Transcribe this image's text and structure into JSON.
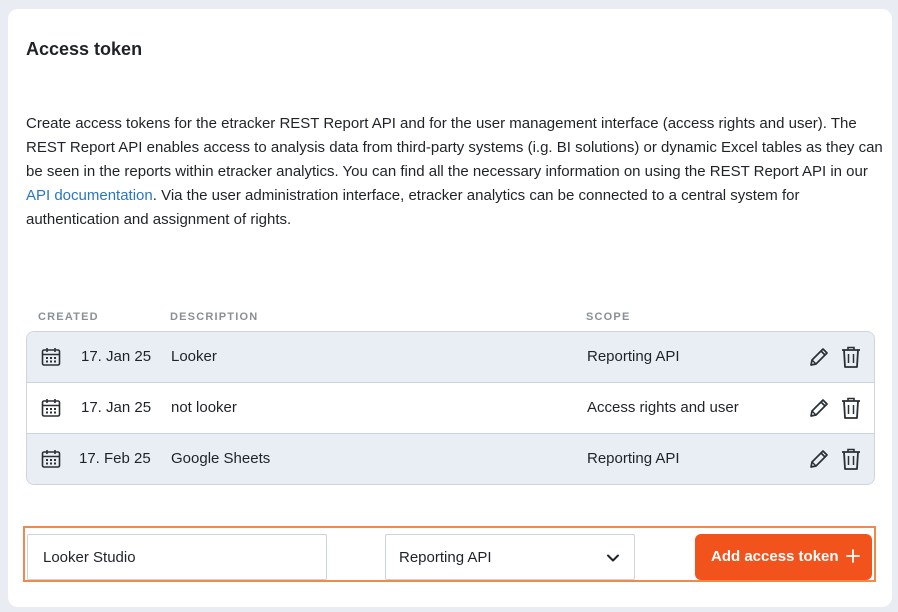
{
  "panel": {
    "title": "Access token",
    "description_part1": "Create access tokens for the etracker REST Report API and for the user management interface (access rights and user). The REST Report API enables access to analysis data from third-party systems (i.g. BI solutions) or dynamic Excel tables as they can be seen in the reports within etracker analytics. You can find all the necessary information on using the REST Report API in our ",
    "description_link": "API documentation",
    "description_part2": ". Via the user administration interface, etracker analytics can be connected to a central system for authentication and assignment of rights."
  },
  "table": {
    "headers": {
      "created": "CREATED",
      "description": "DESCRIPTION",
      "scope": "SCOPE"
    },
    "rows": [
      {
        "created": "17. Jan 25",
        "description": "Looker",
        "scope": "Reporting API"
      },
      {
        "created": "17. Jan 25",
        "description": "not looker",
        "scope": "Access rights and user"
      },
      {
        "created": "17. Feb 25",
        "description": "Google Sheets",
        "scope": "Reporting API"
      }
    ]
  },
  "form": {
    "description_value": "Looker Studio",
    "scope_selected": "Reporting API",
    "add_button_label": "Add access token"
  },
  "colors": {
    "accent": "#f2521c",
    "focus_outline": "#f08a4b",
    "link": "#2a76c4",
    "row_alt": "#e9eef4"
  },
  "icons": {
    "row_date": "calendar-icon",
    "row_edit": "pencil-icon",
    "row_delete": "trash-icon",
    "select": "chevron-down-icon",
    "button": "plus-icon"
  }
}
